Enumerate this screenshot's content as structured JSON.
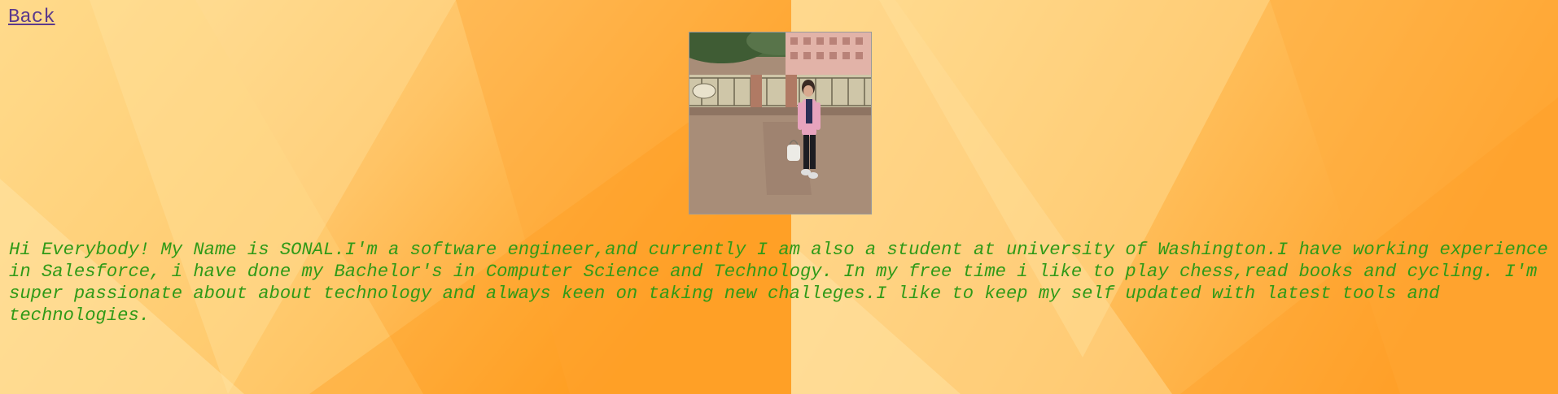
{
  "nav": {
    "back_label": "Back"
  },
  "profile": {
    "photo_alt": "SONAL",
    "bio": "Hi Everybody! My Name is SONAL.I'm a software engineer,and currently I am also a student at university of Washington.I have working experience in Salesforce, i have done my Bachelor's in Computer Science and Technology. In my free time i like to play chess,read books and cycling. I'm super passionate about about technology and always keen on taking new challeges.I like to keep my self updated with latest tools and technologies."
  },
  "theme": {
    "background_light": "#ffd98a",
    "background_dark": "#ff9d1f",
    "bio_color": "#2f9a17",
    "link_color": "#5b3a8c"
  }
}
